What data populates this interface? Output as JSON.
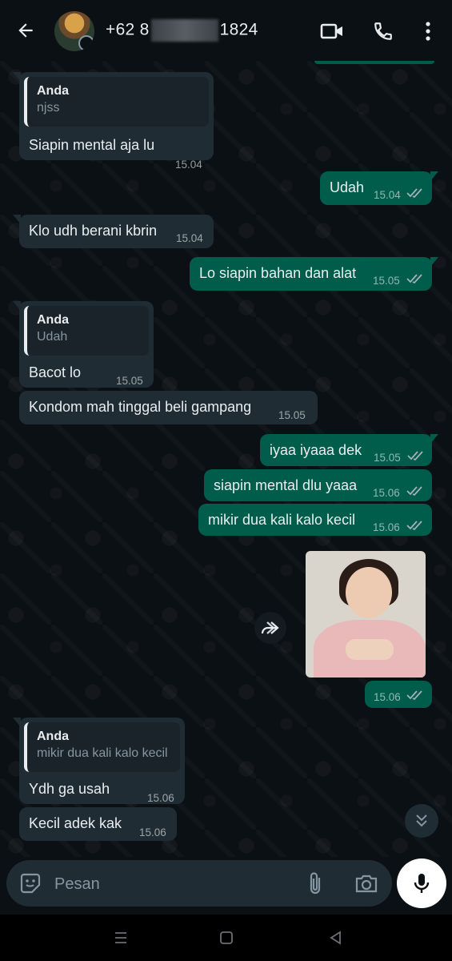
{
  "header": {
    "title_prefix": "+62 8",
    "title_suffix": "1824",
    "icons": [
      "back-arrow-icon",
      "video-call-icon",
      "phone-icon",
      "more-vert-icon"
    ]
  },
  "messages": [
    {
      "dir": "in",
      "quote_name": "Anda",
      "quote_text": "njss",
      "text": "Siapin mental aja lu",
      "time": "15.04"
    },
    {
      "dir": "out",
      "text": "Udah",
      "time": "15.04",
      "status": "read"
    },
    {
      "dir": "in",
      "text": "Klo udh berani kbrin",
      "time": "15.04"
    },
    {
      "dir": "out",
      "text": "Lo siapin bahan dan alat",
      "time": "15.05",
      "status": "read"
    },
    {
      "dir": "in",
      "quote_name": "Anda",
      "quote_text": "Udah",
      "text": "Bacot lo",
      "time": "15.05"
    },
    {
      "dir": "in",
      "text": "Kondom mah tinggal beli gampang",
      "time": "15.05"
    },
    {
      "dir": "out",
      "text": "iyaa iyaaa dek",
      "time": "15.05",
      "status": "read"
    },
    {
      "dir": "out",
      "text": "siapin mental dlu yaaa",
      "time": "15.06",
      "status": "read"
    },
    {
      "dir": "out",
      "text": "mikir dua kali kalo kecil",
      "time": "15.06",
      "status": "read"
    },
    {
      "dir": "out",
      "type": "image",
      "text": "",
      "time": "15.06",
      "status": "read"
    },
    {
      "dir": "in",
      "quote_name": "Anda",
      "quote_text": "mikir dua kali kalo kecil",
      "text": "Ydh ga usah",
      "time": "15.06"
    },
    {
      "dir": "in",
      "text": "Kecil adek kak",
      "time": "15.06"
    }
  ],
  "composer": {
    "placeholder": "Pesan",
    "icons": [
      "sticker-icon",
      "attach-icon",
      "camera-icon",
      "mic-icon"
    ]
  },
  "colors": {
    "background": "#0b1014",
    "incoming_bubble": "#1f2c34",
    "outgoing_bubble": "#005c4b",
    "read_ticks": "#8696a0"
  }
}
